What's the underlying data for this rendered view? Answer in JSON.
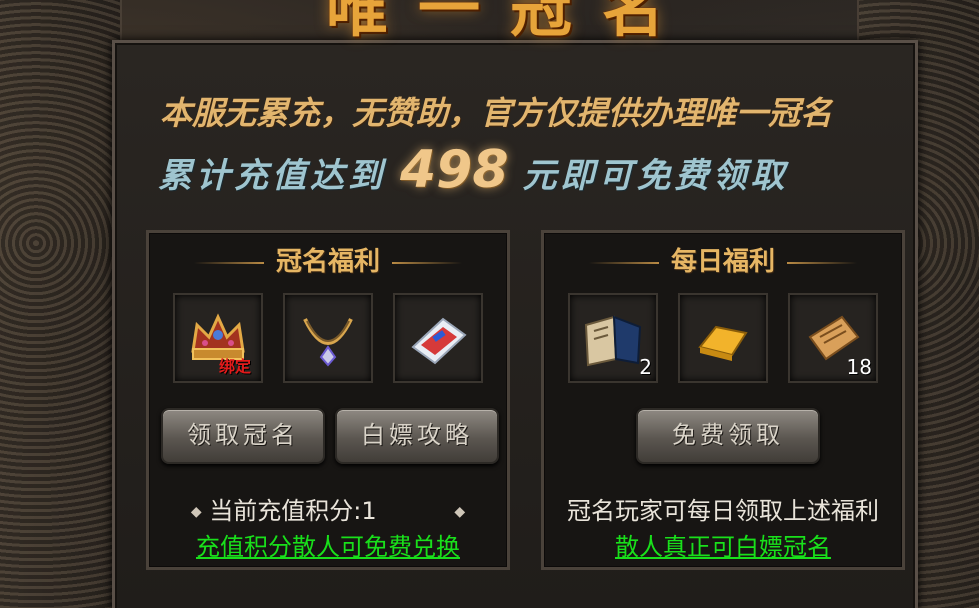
{
  "title": "唯一冠名",
  "line1": "本服无累充，无赞助，官方仅提供办理唯一冠名",
  "line2": {
    "prefix": "累计充值达到",
    "amount": "498",
    "suffix": "元即可免费领取"
  },
  "panel_left": {
    "title": "冠名福利",
    "items": [
      {
        "icon": "crown-icon",
        "badge": "绑定",
        "qty": ""
      },
      {
        "icon": "necklace-icon",
        "badge": "",
        "qty": ""
      },
      {
        "icon": "ticket-book-icon",
        "badge": "",
        "qty": ""
      }
    ],
    "buttons": [
      "领取冠名",
      "白嫖攻略"
    ],
    "info": "当前充值积分:1",
    "link": "充值积分散人可免费兑换"
  },
  "panel_right": {
    "title": "每日福利",
    "items": [
      {
        "icon": "skill-book-icon",
        "badge": "",
        "qty": "2"
      },
      {
        "icon": "gold-bar-icon",
        "badge": "",
        "qty": ""
      },
      {
        "icon": "scroll-icon",
        "badge": "",
        "qty": "18"
      }
    ],
    "buttons": [
      "免费领取"
    ],
    "info": "冠名玩家可每日领取上述福利",
    "link": "散人真正可白嫖冠名"
  },
  "colors": {
    "gold": "#e6b664",
    "teal": "#9fc5cf",
    "link_green": "#19e01b",
    "bound_red": "#e21b1b"
  }
}
